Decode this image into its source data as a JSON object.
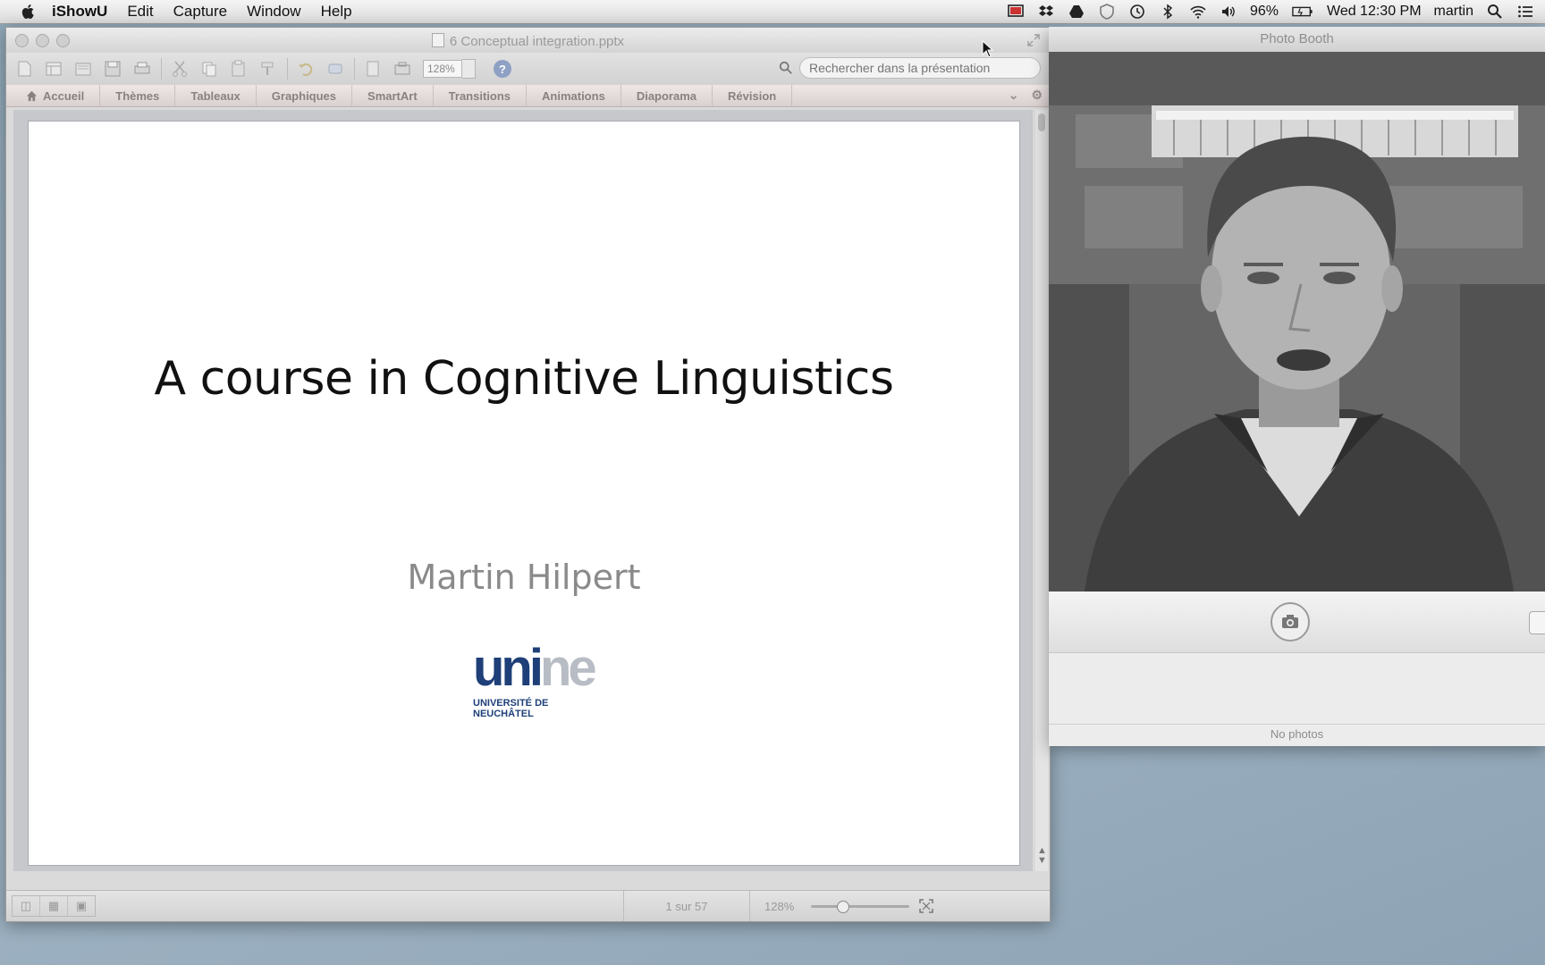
{
  "menubar": {
    "app_name": "iShowU",
    "items": [
      "Edit",
      "Capture",
      "Window",
      "Help"
    ],
    "battery": "96%",
    "clock": "Wed 12:30 PM",
    "user": "martin",
    "status_icons": [
      "screen-recording-icon",
      "dropbox-icon",
      "drive-icon",
      "shield-icon",
      "time-machine-icon",
      "bluetooth-icon",
      "wifi-icon",
      "volume-icon",
      "battery-icon",
      "spotlight-icon",
      "notification-list-icon"
    ]
  },
  "ppt": {
    "title": "6 Conceptual integration.pptx",
    "zoom": "128%",
    "search_placeholder": "Rechercher dans la présentation",
    "ribbon_tabs": [
      "Accueil",
      "Thèmes",
      "Tableaux",
      "Graphiques",
      "SmartArt",
      "Transitions",
      "Animations",
      "Diaporama",
      "Révision"
    ],
    "slide": {
      "title": "A course in Cognitive Linguistics",
      "subtitle": "Martin Hilpert",
      "logo_uni": "uni",
      "logo_ne": "ne",
      "logo_line1": "UNIVERSITÉ DE",
      "logo_line2": "NEUCHÂTEL"
    },
    "status": {
      "slide_count": "1 sur 57",
      "zoom": "128%",
      "zoom_slider_fraction": 0.3
    }
  },
  "photobooth": {
    "title": "Photo Booth",
    "gallery_text": "No photos"
  }
}
